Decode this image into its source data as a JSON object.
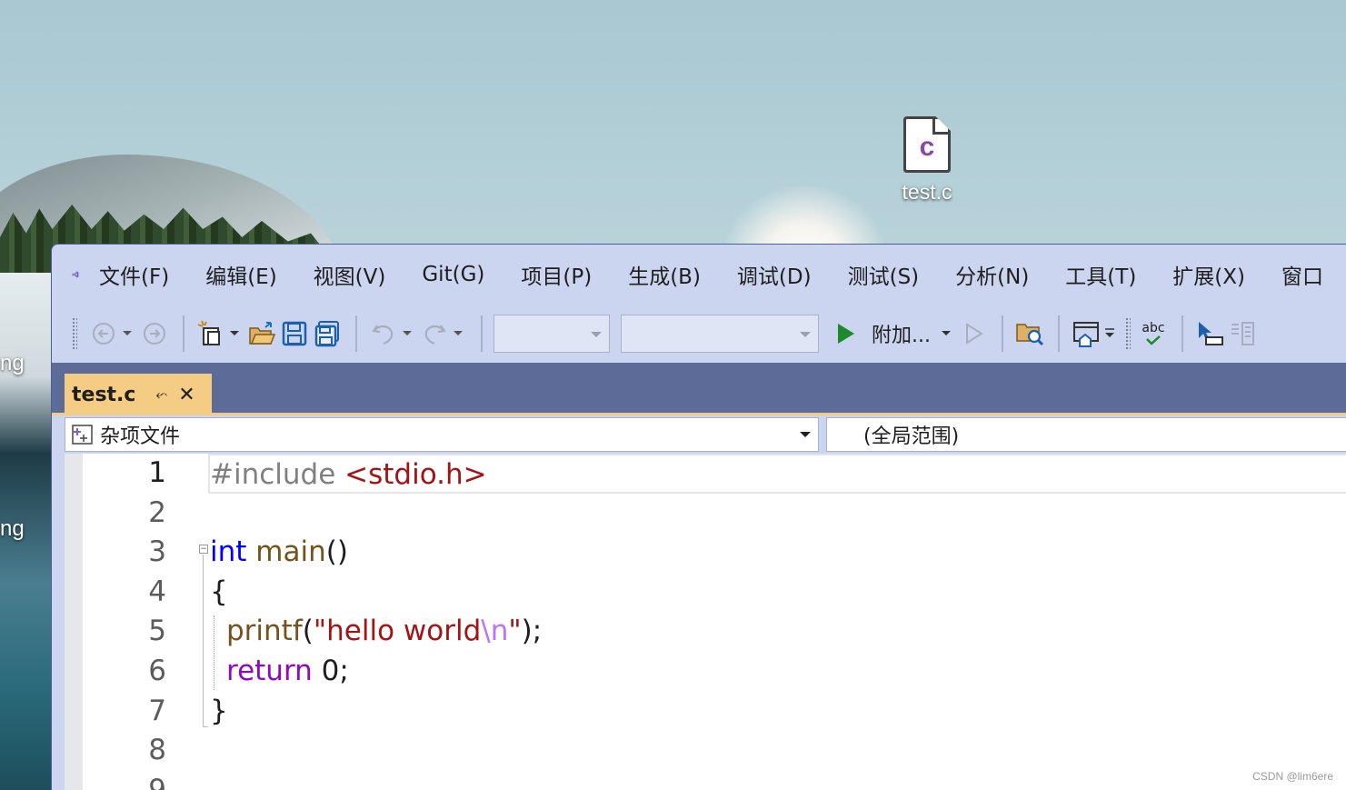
{
  "desktop": {
    "file_name": "test.c",
    "file_icon_letter": "c",
    "left_labels": [
      "ng",
      "ng"
    ]
  },
  "menu": {
    "items": [
      "文件(F)",
      "编辑(E)",
      "视图(V)",
      "Git(G)",
      "项目(P)",
      "生成(B)",
      "调试(D)",
      "测试(S)",
      "分析(N)",
      "工具(T)",
      "扩展(X)",
      "窗口"
    ]
  },
  "toolbar": {
    "attach_label": "附加...",
    "spell_label": "abc"
  },
  "tab": {
    "title": "test.c",
    "pin_icon": "pin-icon",
    "close_icon": "close-icon"
  },
  "navbar": {
    "project": "杂项文件",
    "scope": "(全局范围)"
  },
  "editor": {
    "line_numbers": [
      "1",
      "2",
      "3",
      "4",
      "5",
      "6",
      "7",
      "8",
      "9"
    ],
    "code": {
      "l1_directive": "#include",
      "l1_header": "<stdio.h>",
      "l3_type": "int",
      "l3_name": "main",
      "l3_parens": "()",
      "l4": "{",
      "l5_fn": "printf",
      "l5_open": "(",
      "l5_str_a": "\"hello world",
      "l5_esc": "\\n",
      "l5_str_b": "\"",
      "l5_close": ");",
      "l6_kw": "return",
      "l6_val": " 0;",
      "l7": "}"
    }
  },
  "watermark": "CSDN @lim6ere",
  "colors": {
    "menubar_bg": "#ccd5f0",
    "tabstrip_bg": "#5d6b99",
    "active_tab": "#f5cc84",
    "keyword_blue": "#0000ff",
    "string_red": "#a31515",
    "control_purple": "#8f08c4",
    "vs_purple": "#865fc5"
  }
}
